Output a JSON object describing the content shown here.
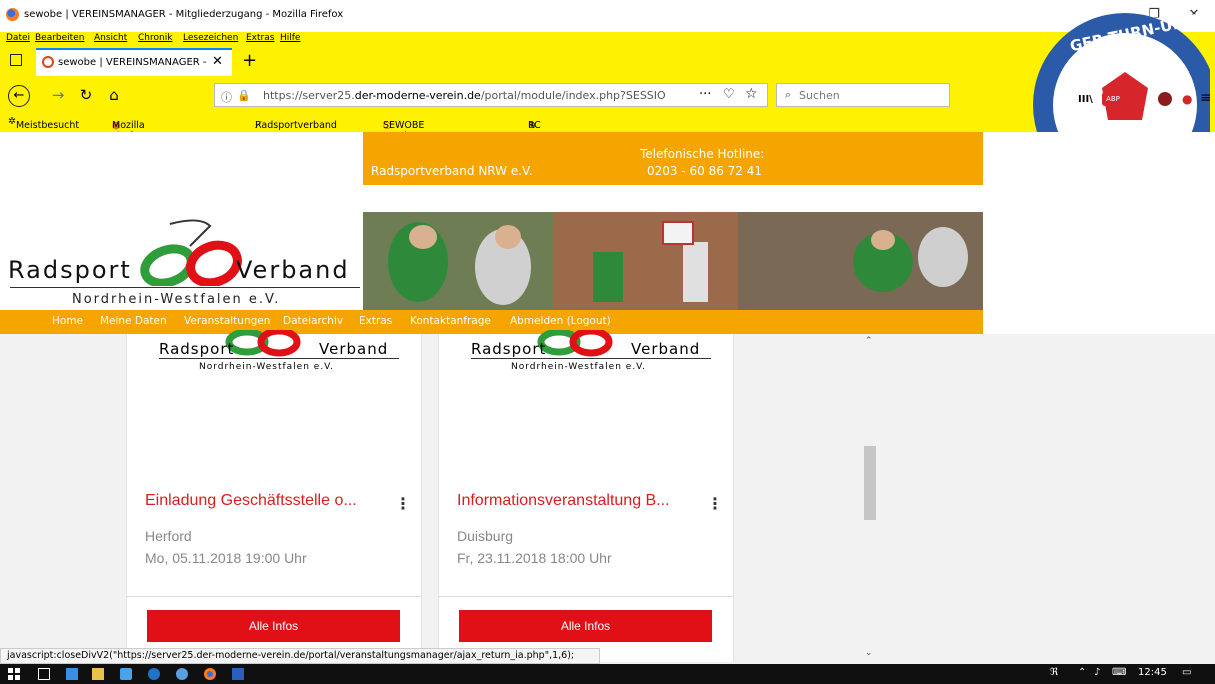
{
  "window": {
    "title": "sewobe | VEREINSMANAGER - Mitgliederzugang - Mozilla Firefox",
    "controls": {
      "minimize": "–",
      "restore": "❐",
      "close": "✕"
    }
  },
  "menu": [
    "Datei",
    "Bearbeiten",
    "Ansicht",
    "Chronik",
    "Lesezeichen",
    "Extras",
    "Hilfe"
  ],
  "tab": {
    "label": "sewobe | VEREINSMANAGER - ",
    "close": "✕",
    "new": "+"
  },
  "nav": {
    "back": "←",
    "forward": "→",
    "reload": "↻",
    "home": "⌂",
    "url_prefix": "https://server25.",
    "url_domain": "der-moderne-verein.de",
    "url_path": "/portal/module/index.php?SESSIO",
    "page_actions": "···",
    "pocket": "♡",
    "bookmark_star": "☆",
    "search_placeholder": "Suchen"
  },
  "bookmarks": [
    "Meistbesucht",
    "Mozilla Firefox-Startsei...",
    "Radsportverband NRW",
    "SEWOBE Vereinsmana...",
    "RC Buer Admin"
  ],
  "header": {
    "org_name": "Radsportverband NRW e.V.",
    "hotline_label": "Telefonische Hotline:",
    "hotline_number": "0203 - 60 86 72 41"
  },
  "logo": {
    "word_left": "Radsport",
    "word_right": "Verband",
    "subtitle": "Nordrhein-Westfalen e.V."
  },
  "main_nav": [
    "Home",
    "Meine Daten",
    "Veranstaltungen",
    "Dateiarchiv",
    "Extras",
    "Kontaktanfrage",
    "Abmelden (Logout)"
  ],
  "events": [
    {
      "title": "Einladung Geschäftsstelle o...",
      "city": "Herford",
      "date": "Mo, 05.11.2018 19:00 Uhr",
      "button": "Alle Infos"
    },
    {
      "title": "Informationsveranstaltung B...",
      "city": "Duisburg",
      "date": "Fr, 23.11.2018 18:00 Uhr",
      "button": "Alle Infos"
    }
  ],
  "card_menu_glyph": "⋮",
  "status_text": "javascript:closeDivV2(\"https://server25.der-moderne-verein.de/portal/veranstaltungsmanager/ajax_return_ia.php\",1,6);",
  "emblem_text": "BRAUNSCHWEIGER TURN-U.SPORTVEREIN",
  "tray": {
    "time": "12:45"
  },
  "colors": {
    "firefox_bar": "#fff200",
    "orange": "#f5a400",
    "red": "#e10f16",
    "green": "#2e9d3a"
  }
}
